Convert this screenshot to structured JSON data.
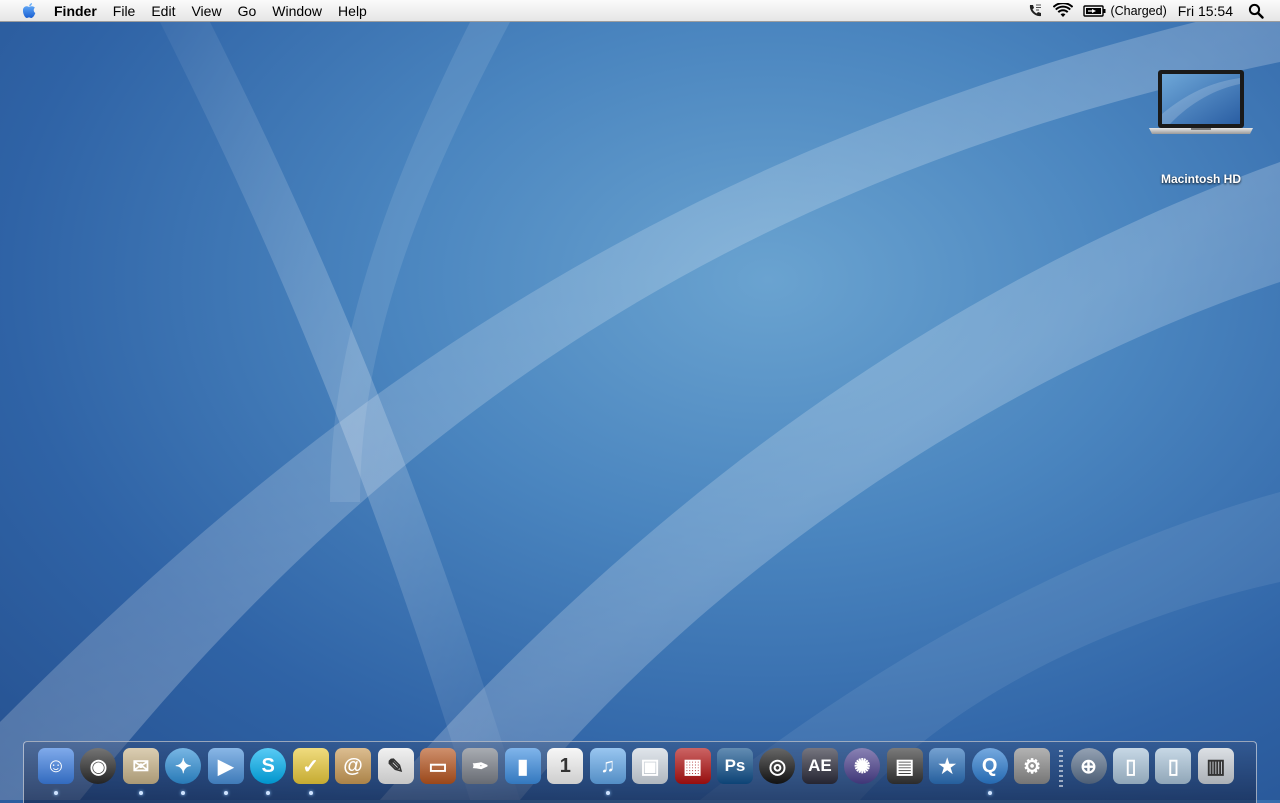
{
  "menubar": {
    "apple_icon": "apple-icon",
    "app_name": "Finder",
    "menus": [
      "File",
      "Edit",
      "View",
      "Go",
      "Window",
      "Help"
    ],
    "status": {
      "phone_icon": "phone-icon",
      "wifi_icon": "wifi-icon",
      "battery_icon": "battery-icon",
      "battery_text": "(Charged)",
      "clock": "Fri 15:54",
      "spotlight_icon": "spotlight-search-icon"
    }
  },
  "desktop": {
    "icons": [
      {
        "label": "Macintosh HD",
        "icon": "laptop-icon"
      }
    ]
  },
  "dock": {
    "apps": [
      {
        "icon": "finder-icon",
        "running": true,
        "color": "#3b7de0"
      },
      {
        "icon": "dashboard-icon",
        "running": false,
        "color": "#2a2a2a"
      },
      {
        "icon": "mail-stamp-icon",
        "running": true,
        "color": "#c8b48a"
      },
      {
        "icon": "safari-compass-icon",
        "running": true,
        "color": "#2f8fd6"
      },
      {
        "icon": "ichat-icon",
        "running": true,
        "color": "#4a90d9"
      },
      {
        "icon": "skype-icon",
        "running": true,
        "color": "#00aff0"
      },
      {
        "icon": "bird-icon",
        "running": true,
        "color": "#e8c93a"
      },
      {
        "icon": "address-book-icon",
        "running": false,
        "color": "#c99a55"
      },
      {
        "icon": "textedit-icon",
        "running": false,
        "color": "#e9e9e9"
      },
      {
        "icon": "keynote-icon",
        "running": false,
        "color": "#b5541e"
      },
      {
        "icon": "pen-tool-icon",
        "running": false,
        "color": "#7a7f88"
      },
      {
        "icon": "numbers-chart-icon",
        "running": false,
        "color": "#3c8de0"
      },
      {
        "icon": "calendar-icon",
        "running": false,
        "color": "#f2f2f2"
      },
      {
        "icon": "itunes-icon",
        "running": true,
        "color": "#62a7e8"
      },
      {
        "icon": "preview-photos-icon",
        "running": false,
        "color": "#cfd7e0"
      },
      {
        "icon": "photo-booth-icon",
        "running": false,
        "color": "#b01010"
      },
      {
        "icon": "photoshop-icon",
        "running": false,
        "color": "#0f4f8a"
      },
      {
        "icon": "camera-lens-icon",
        "running": false,
        "color": "#151515"
      },
      {
        "icon": "after-effects-icon",
        "running": false,
        "color": "#2b2b3a"
      },
      {
        "icon": "aperture-icon",
        "running": false,
        "color": "#4a3f8c"
      },
      {
        "icon": "clapperboard-icon",
        "running": false,
        "color": "#333333"
      },
      {
        "icon": "imovie-icon",
        "running": false,
        "color": "#2b6fb8"
      },
      {
        "icon": "quicktime-icon",
        "running": true,
        "color": "#2b7bcf"
      },
      {
        "icon": "system-preferences-icon",
        "running": false,
        "color": "#8a8a8a"
      }
    ],
    "stacks": [
      {
        "icon": "network-utility-icon",
        "color": "#5a6f8a"
      },
      {
        "icon": "documents-folder-icon",
        "color": "#a9c3d8"
      },
      {
        "icon": "downloads-folder-icon",
        "color": "#a9c3d8"
      },
      {
        "icon": "trash-icon",
        "color": "#c9cfd6"
      }
    ]
  }
}
